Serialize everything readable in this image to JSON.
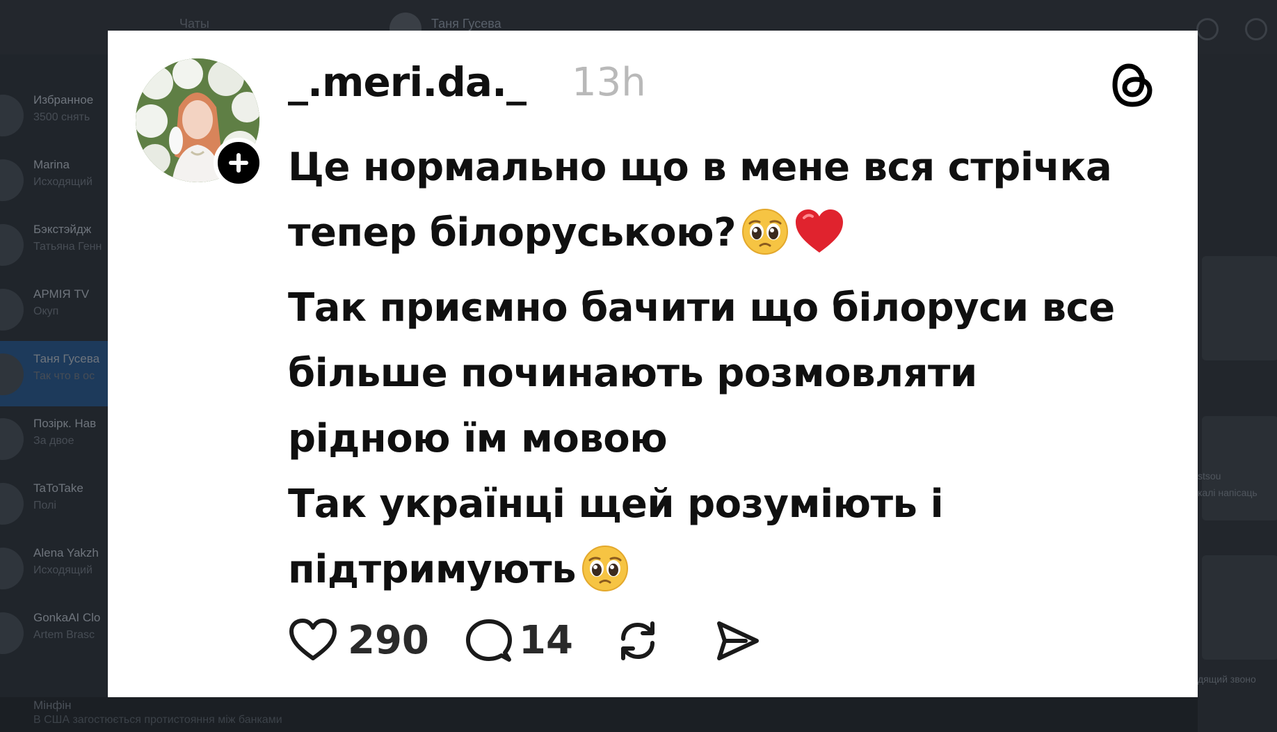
{
  "background": {
    "topbar": {
      "chats_label": "Чаты",
      "active_chat_name": "Таня Гусева"
    },
    "sidebar_chats": [
      {
        "name": "Избранное",
        "preview": "3500 снять"
      },
      {
        "name": "Marina",
        "preview": "Исходящий"
      },
      {
        "name": "Бэкстэйдж",
        "preview": "Татьяна Генн"
      },
      {
        "name": "АРМІЯ TV",
        "preview": "Окуп"
      },
      {
        "name": "Таня Гусева",
        "preview": "Так что в ос"
      },
      {
        "name": "Позірк. Нав",
        "preview": "За двое"
      },
      {
        "name": "TaToTake",
        "preview": "Полі"
      },
      {
        "name": "Alena Yakzh",
        "preview": "Исходящий"
      },
      {
        "name": "GonkaAI Clo",
        "preview": "Artem Brasc"
      }
    ],
    "bottom_chat": {
      "name": "Мінфін",
      "preview": "В США загостюється протистояння між банками"
    },
    "right_panel": {
      "snippet_1": "stsou",
      "snippet_2": "калі напісаць",
      "snippet_3": "дящий звоно"
    }
  },
  "post": {
    "username": "_.meri.da._",
    "time": "13h",
    "text_lines": [
      "Це нормально що в мене вся стрічка",
      "тепер білоруською?",
      "Так приємно бачити що білоруси все",
      "більше починають розмовляти",
      "рідною їм мовою",
      "Так українці щей розуміють і",
      "підтримують"
    ],
    "emojis": {
      "pleading": "pleading-face-emoji",
      "heart": "red-heart-emoji"
    },
    "likes": "290",
    "replies": "14"
  },
  "colors": {
    "card_bg": "#ffffff",
    "text": "#101010",
    "timestamp": "#b9b9b9",
    "backdrop": "#1f2328"
  }
}
